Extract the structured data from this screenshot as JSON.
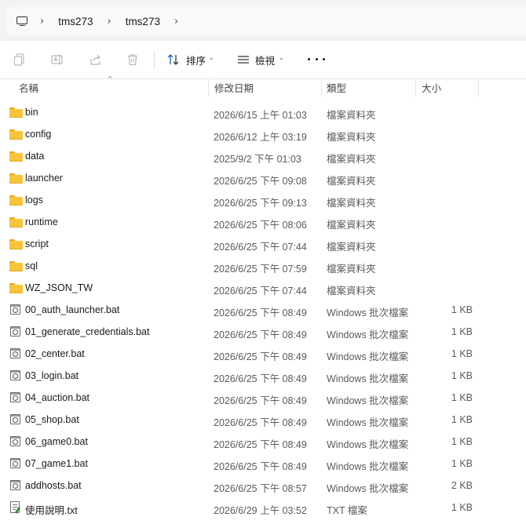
{
  "address_bar": {
    "breadcrumbs": [
      "tms273",
      "tms273"
    ]
  },
  "toolbar": {
    "sort_label": "排序",
    "view_label": "檢視"
  },
  "columns": {
    "name": "名稱",
    "date": "修改日期",
    "type": "類型",
    "size": "大小"
  },
  "files": [
    {
      "name": "bin",
      "date": "2026/6/15 上午 01:03",
      "type": "檔案資料夾",
      "size": "",
      "icon": "folder-icon"
    },
    {
      "name": "config",
      "date": "2026/6/12 上午 03:19",
      "type": "檔案資料夾",
      "size": "",
      "icon": "folder-icon"
    },
    {
      "name": "data",
      "date": "2025/9/2 下午 01:03",
      "type": "檔案資料夾",
      "size": "",
      "icon": "folder-icon"
    },
    {
      "name": "launcher",
      "date": "2026/6/25 下午 09:08",
      "type": "檔案資料夾",
      "size": "",
      "icon": "folder-icon"
    },
    {
      "name": "logs",
      "date": "2026/6/25 下午 09:13",
      "type": "檔案資料夾",
      "size": "",
      "icon": "folder-icon"
    },
    {
      "name": "runtime",
      "date": "2026/6/25 下午 08:06",
      "type": "檔案資料夾",
      "size": "",
      "icon": "folder-icon"
    },
    {
      "name": "script",
      "date": "2026/6/25 下午 07:44",
      "type": "檔案資料夾",
      "size": "",
      "icon": "folder-icon"
    },
    {
      "name": "sql",
      "date": "2026/6/25 下午 07:59",
      "type": "檔案資料夾",
      "size": "",
      "icon": "folder-icon"
    },
    {
      "name": "WZ_JSON_TW",
      "date": "2026/6/25 下午 07:44",
      "type": "檔案資料夾",
      "size": "",
      "icon": "folder-icon"
    },
    {
      "name": "00_auth_launcher.bat",
      "date": "2026/6/25 下午 08:49",
      "type": "Windows 批次檔案",
      "size": "1 KB",
      "icon": "batch-file-icon"
    },
    {
      "name": "01_generate_credentials.bat",
      "date": "2026/6/25 下午 08:49",
      "type": "Windows 批次檔案",
      "size": "1 KB",
      "icon": "batch-file-icon"
    },
    {
      "name": "02_center.bat",
      "date": "2026/6/25 下午 08:49",
      "type": "Windows 批次檔案",
      "size": "1 KB",
      "icon": "batch-file-icon"
    },
    {
      "name": "03_login.bat",
      "date": "2026/6/25 下午 08:49",
      "type": "Windows 批次檔案",
      "size": "1 KB",
      "icon": "batch-file-icon"
    },
    {
      "name": "04_auction.bat",
      "date": "2026/6/25 下午 08:49",
      "type": "Windows 批次檔案",
      "size": "1 KB",
      "icon": "batch-file-icon"
    },
    {
      "name": "05_shop.bat",
      "date": "2026/6/25 下午 08:49",
      "type": "Windows 批次檔案",
      "size": "1 KB",
      "icon": "batch-file-icon"
    },
    {
      "name": "06_game0.bat",
      "date": "2026/6/25 下午 08:49",
      "type": "Windows 批次檔案",
      "size": "1 KB",
      "icon": "batch-file-icon"
    },
    {
      "name": "07_game1.bat",
      "date": "2026/6/25 下午 08:49",
      "type": "Windows 批次檔案",
      "size": "1 KB",
      "icon": "batch-file-icon"
    },
    {
      "name": "addhosts.bat",
      "date": "2026/6/25 下午 08:57",
      "type": "Windows 批次檔案",
      "size": "2 KB",
      "icon": "batch-file-icon"
    },
    {
      "name": "使用說明.txt",
      "date": "2026/6/29 上午 03:52",
      "type": "TXT 檔案",
      "size": "1 KB",
      "icon": "text-file-icon"
    }
  ]
}
